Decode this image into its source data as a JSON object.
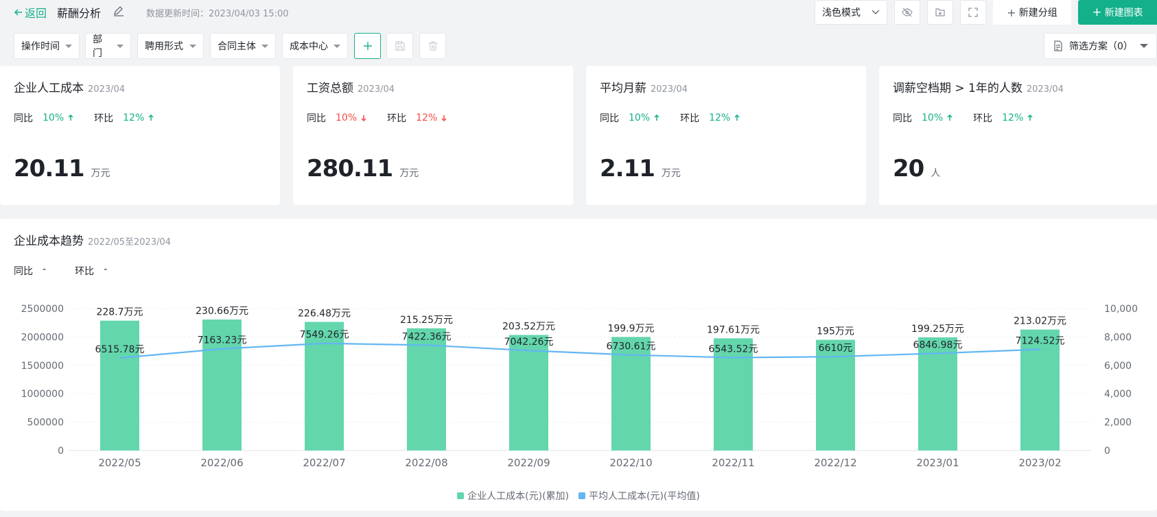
{
  "header": {
    "back_label": "返回",
    "title": "薪酬分析",
    "update_time_label": "数据更新时间：2023/04/03 15:00",
    "mode_select": "浅色模式",
    "add_group_label": "新建分组",
    "new_chart_label": "新建图表"
  },
  "filters": {
    "items": [
      "操作时间",
      "部门",
      "聘用形式",
      "合同主体",
      "成本中心"
    ],
    "scheme_label": "筛选方案（0）"
  },
  "colors": {
    "accent": "#13b08a",
    "up": "#13b08a",
    "down": "#f54a45",
    "bar": "#63d6ac",
    "line": "#62b6f2"
  },
  "cards": [
    {
      "title": "企业人工成本",
      "period": "2023/04",
      "yoy_label": "同比",
      "yoy": "10%",
      "yoy_dir": "up",
      "mom_label": "环比",
      "mom": "12%",
      "mom_dir": "up",
      "value": "20.11",
      "unit": "万元"
    },
    {
      "title": "工资总额",
      "period": "2023/04",
      "yoy_label": "同比",
      "yoy": "10%",
      "yoy_dir": "down",
      "mom_label": "环比",
      "mom": "12%",
      "mom_dir": "down",
      "value": "280.11",
      "unit": "万元"
    },
    {
      "title": "平均月薪",
      "period": "2023/04",
      "yoy_label": "同比",
      "yoy": "10%",
      "yoy_dir": "up",
      "mom_label": "环比",
      "mom": "12%",
      "mom_dir": "up",
      "value": "2.11",
      "unit": "万元"
    },
    {
      "title": "调薪空档期 > 1年的人数",
      "period": "2023/04",
      "yoy_label": "同比",
      "yoy": "10%",
      "yoy_dir": "up",
      "mom_label": "环比",
      "mom": "12%",
      "mom_dir": "up",
      "value": "20",
      "unit": "人"
    }
  ],
  "trend": {
    "title": "企业成本趋势",
    "period": "2022/05至2023/04",
    "yoy_label": "同比",
    "yoy": "-",
    "mom_label": "环比",
    "mom": "-"
  },
  "chart_data": {
    "type": "bar",
    "categories": [
      "2022/05",
      "2022/06",
      "2022/07",
      "2022/08",
      "2022/09",
      "2022/10",
      "2022/11",
      "2022/12",
      "2023/01",
      "2023/02"
    ],
    "series": [
      {
        "name": "企业人工成本(元)(累加)",
        "type": "bar",
        "axis": "left",
        "values": [
          2287000,
          2306600,
          2264800,
          2152500,
          2035200,
          1999000,
          1976100,
          1950000,
          1992500,
          2130200
        ],
        "labels": [
          "228.7万元",
          "230.66万元",
          "226.48万元",
          "215.25万元",
          "203.52万元",
          "199.9万元",
          "197.61万元",
          "195万元",
          "199.25万元",
          "213.02万元"
        ]
      },
      {
        "name": "平均人工成本(元)(平均值)",
        "type": "line",
        "axis": "right",
        "values": [
          6515.78,
          7163.23,
          7549.26,
          7422.36,
          7042.26,
          6730.61,
          6543.52,
          6610,
          6846.98,
          7124.52
        ],
        "labels": [
          "6515.78元",
          "7163.23元",
          "7549.26元",
          "7422.36元",
          "7042.26元",
          "6730.61元",
          "6543.52元",
          "6610元",
          "6846.98元",
          "7124.52元"
        ]
      }
    ],
    "y_left": {
      "ticks": [
        "2500000",
        "2000000",
        "1500000",
        "1000000",
        "500000",
        "0"
      ],
      "ylim": [
        0,
        2500000
      ]
    },
    "y_right": {
      "ticks": [
        "10,000",
        "8,000",
        "6,000",
        "4,000",
        "2,000",
        "0"
      ],
      "ylim": [
        0,
        10000
      ]
    },
    "grid": true,
    "legend_position": "bottom-center"
  }
}
